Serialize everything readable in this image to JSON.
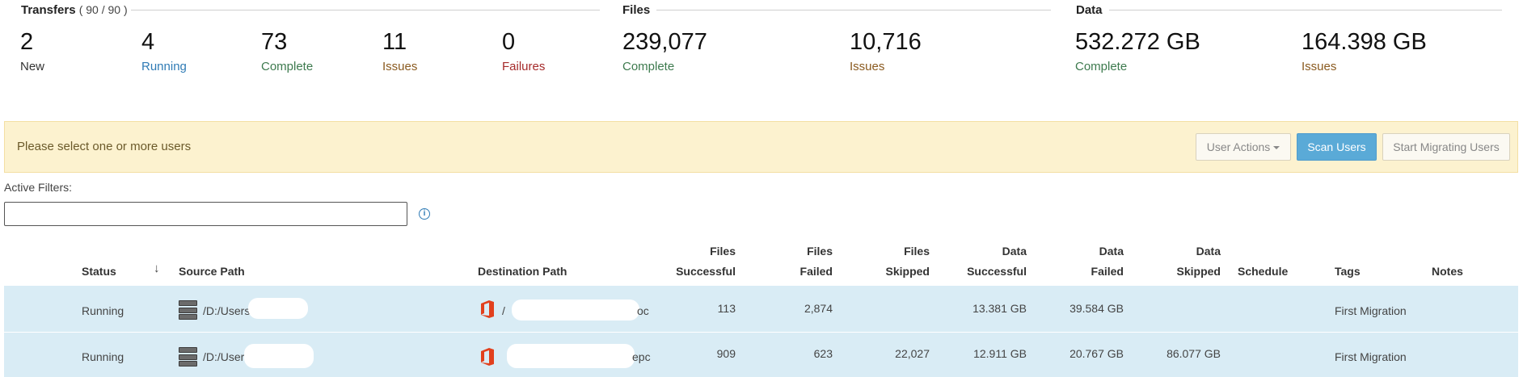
{
  "summary": {
    "transfers": {
      "title": "Transfers",
      "count": "( 90 / 90 )",
      "stats": [
        {
          "value": "2",
          "label": "New"
        },
        {
          "value": "4",
          "label": "Running"
        },
        {
          "value": "73",
          "label": "Complete"
        },
        {
          "value": "11",
          "label": "Issues"
        },
        {
          "value": "0",
          "label": "Failures"
        }
      ]
    },
    "files": {
      "title": "Files",
      "stats": [
        {
          "value": "239,077",
          "label": "Complete"
        },
        {
          "value": "10,716",
          "label": "Issues"
        }
      ]
    },
    "data": {
      "title": "Data",
      "stats": [
        {
          "value": "532.272 GB",
          "label": "Complete"
        },
        {
          "value": "164.398 GB",
          "label": "Issues"
        }
      ]
    }
  },
  "alert": {
    "message": "Please select one or more users",
    "user_actions_label": "User Actions",
    "scan_users_label": "Scan Users",
    "start_migrating_label": "Start Migrating Users"
  },
  "filters": {
    "label": "Active Filters:",
    "value": "",
    "info_icon": "i"
  },
  "table": {
    "headers": {
      "status": "Status",
      "sort_arrow": "↓",
      "source_path": "Source Path",
      "destination_path": "Destination Path",
      "files_successful": [
        "Files",
        "Successful"
      ],
      "files_failed": [
        "Files",
        "Failed"
      ],
      "files_skipped": [
        "Files",
        "Skipped"
      ],
      "data_successful": [
        "Data",
        "Successful"
      ],
      "data_failed": [
        "Data",
        "Failed"
      ],
      "data_skipped": [
        "Data",
        "Skipped"
      ],
      "schedule": "Schedule",
      "tags": "Tags",
      "notes": "Notes"
    },
    "rows": [
      {
        "status": "Running",
        "source_path": "/D:/Users/",
        "destination_path_prefix": "/",
        "destination_path_suffix": "oc",
        "files_successful": "113",
        "files_failed": "2,874",
        "files_skipped": "",
        "data_successful": "13.381 GB",
        "data_failed": "39.584 GB",
        "data_skipped": "",
        "schedule": "",
        "tags": "First Migration",
        "notes": ""
      },
      {
        "status": "Running",
        "source_path": "/D:/User",
        "destination_path_prefix": "",
        "destination_path_suffix": "epc",
        "files_successful": "909",
        "files_failed": "623",
        "files_skipped": "22,027",
        "data_successful": "12.911 GB",
        "data_failed": "20.767 GB",
        "data_skipped": "86.077 GB",
        "schedule": "",
        "tags": "First Migration",
        "notes": ""
      }
    ]
  },
  "icons": {
    "source": "server-icon",
    "destination": "office365-icon",
    "info": "info-circle-icon",
    "dropdown": "caret-down-icon"
  },
  "colors": {
    "running": "#2f7bb5",
    "complete": "#3d7a4e",
    "issues": "#8a5a1f",
    "failures": "#a52a2a",
    "alert_bg": "#fcf2cf",
    "primary_button": "#5aaad7",
    "row_bg": "#d9ecf5",
    "office_red": "#e2401d"
  }
}
